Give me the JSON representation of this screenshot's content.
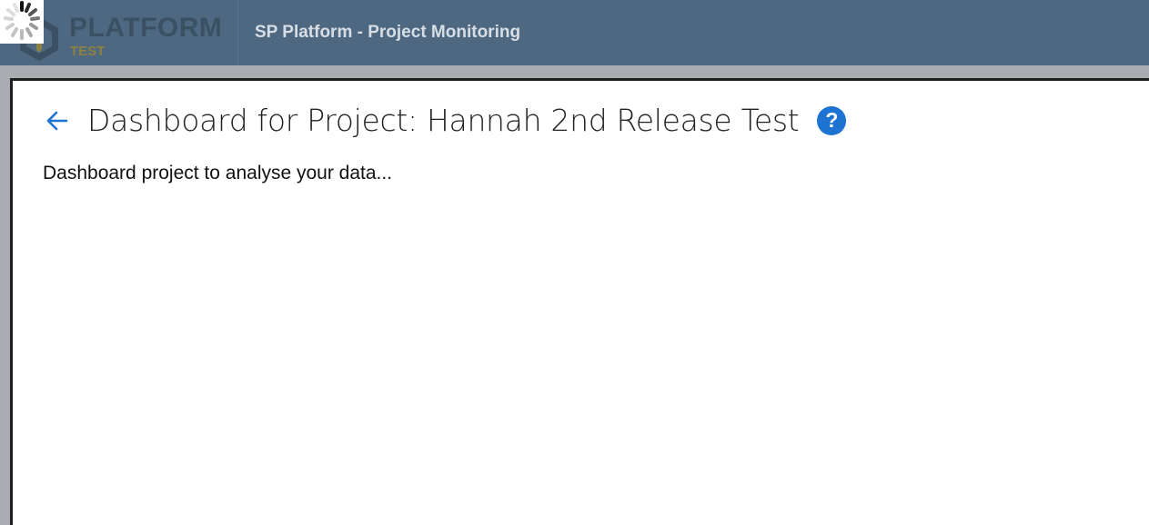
{
  "header": {
    "logo_text": "PLATFORM",
    "logo_subtext": "TEST",
    "app_title": "SP Platform - Project Monitoring"
  },
  "page": {
    "title": "Dashboard for Project: Hannah 2nd Release Test",
    "description": "Dashboard project to analyse your data...",
    "help_glyph": "?"
  },
  "icons": {
    "back": "arrow-left-icon",
    "help": "help-circle-icon",
    "loading": "loading-spinner-icon",
    "logo": "platform-logo-icon"
  },
  "colors": {
    "topbar": "#4d6880",
    "accent": "#1e73d2",
    "logo_sub": "#8d8140"
  }
}
